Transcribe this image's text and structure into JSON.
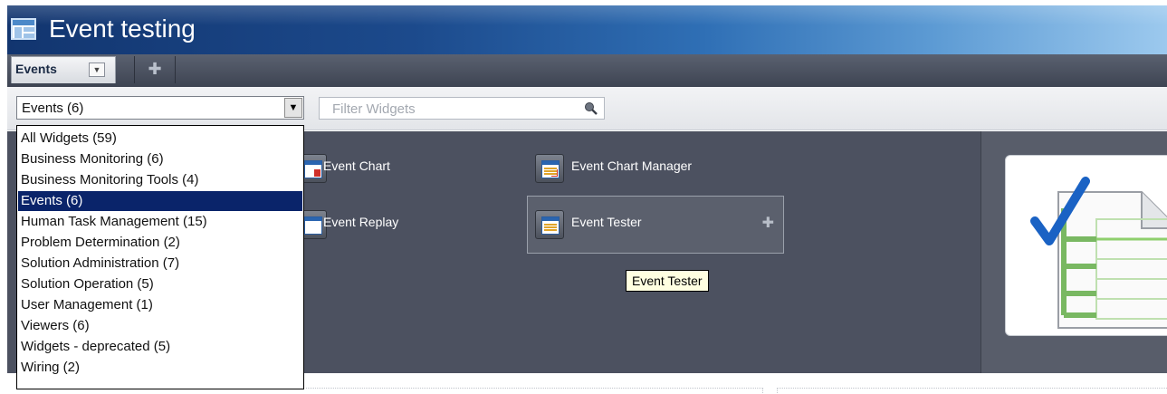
{
  "title": "Event testing",
  "tabs": [
    {
      "label": "Events"
    }
  ],
  "add_tab_symbol": "✚",
  "filter": {
    "selected": "Events (6)",
    "placeholder": "Filter Widgets"
  },
  "dropdown": {
    "options": [
      "All Widgets (59)",
      "Business Monitoring (6)",
      "Business Monitoring Tools (4)",
      "Events (6)",
      "Human Task Management (15)",
      "Problem Determination (2)",
      "Solution Administration (7)",
      "Solution Operation (5)",
      "User Management (1)",
      "Viewers (6)",
      "Widgets - deprecated (5)",
      "Wiring (2)"
    ],
    "active_index": 3
  },
  "widgets": [
    {
      "label": "Event Chart"
    },
    {
      "label": "Event Chart Manager"
    },
    {
      "label": "Event Replay"
    },
    {
      "label": "Event Tester"
    }
  ],
  "tooltip": "Event Tester",
  "icons": {
    "app": "dashboard-app-icon",
    "search": "search-icon",
    "add": "plus-icon"
  },
  "colors": {
    "title_bar": "#1c4a8c",
    "widget_area": "#4c5160",
    "selection": "#0a246a",
    "tooltip": "#ffffe1"
  }
}
